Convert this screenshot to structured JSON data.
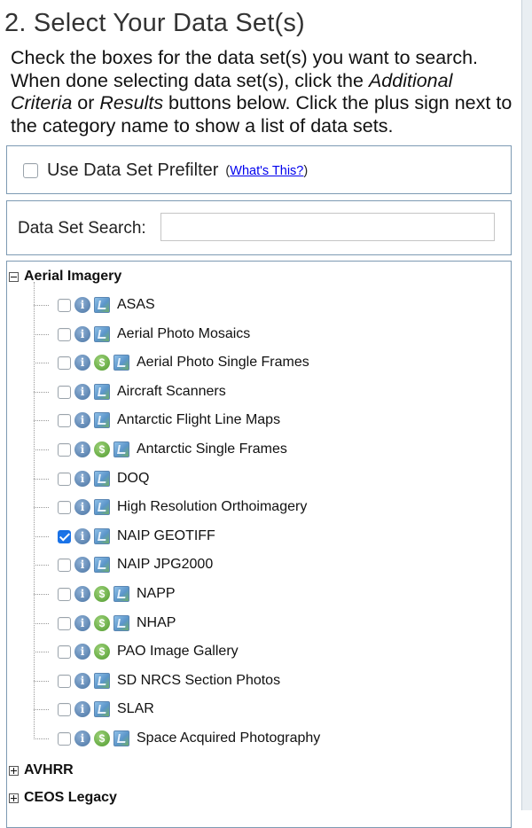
{
  "step": {
    "title": "2. Select Your Data Set(s)"
  },
  "instructions": {
    "part1": "Check the boxes for the data set(s) you want to search. When done selecting data set(s), click the ",
    "em1": "Additional Criteria",
    "part2": " or ",
    "em2": "Results",
    "part3": " buttons below. Click the plus sign next to the category name to show a list of data sets."
  },
  "prefilter": {
    "label": "Use Data Set Prefilter",
    "paren_open": "(",
    "link": "What's This?",
    "paren_close": ")",
    "checked": false
  },
  "search": {
    "label": "Data Set Search:",
    "value": "",
    "placeholder": ""
  },
  "tree": {
    "aerial": {
      "label": "Aerial Imagery",
      "expanded": true,
      "items": [
        {
          "label": "ASAS",
          "checked": false,
          "icons": [
            "info-icon",
            "map-icon"
          ]
        },
        {
          "label": "Aerial Photo Mosaics",
          "checked": false,
          "icons": [
            "info-icon",
            "map-icon"
          ]
        },
        {
          "label": "Aerial Photo Single Frames",
          "checked": false,
          "icons": [
            "info-icon",
            "dollar-icon",
            "map-icon"
          ]
        },
        {
          "label": "Aircraft Scanners",
          "checked": false,
          "icons": [
            "info-icon",
            "map-icon"
          ]
        },
        {
          "label": "Antarctic Flight Line Maps",
          "checked": false,
          "icons": [
            "info-icon",
            "map-icon"
          ]
        },
        {
          "label": "Antarctic Single Frames",
          "checked": false,
          "icons": [
            "info-icon",
            "dollar-icon",
            "map-icon"
          ]
        },
        {
          "label": "DOQ",
          "checked": false,
          "icons": [
            "info-icon",
            "map-icon"
          ]
        },
        {
          "label": "High Resolution Orthoimagery",
          "checked": false,
          "icons": [
            "info-icon",
            "map-icon"
          ]
        },
        {
          "label": "NAIP GEOTIFF",
          "checked": true,
          "icons": [
            "info-icon",
            "map-icon"
          ]
        },
        {
          "label": "NAIP JPG2000",
          "checked": false,
          "icons": [
            "info-icon",
            "map-icon"
          ]
        },
        {
          "label": "NAPP",
          "checked": false,
          "icons": [
            "info-icon",
            "dollar-icon",
            "map-icon"
          ]
        },
        {
          "label": "NHAP",
          "checked": false,
          "icons": [
            "info-icon",
            "dollar-icon",
            "map-icon"
          ]
        },
        {
          "label": "PAO Image Gallery",
          "checked": false,
          "icons": [
            "info-icon",
            "dollar-icon"
          ]
        },
        {
          "label": "SD NRCS Section Photos",
          "checked": false,
          "icons": [
            "info-icon",
            "map-icon"
          ]
        },
        {
          "label": "SLAR",
          "checked": false,
          "icons": [
            "info-icon",
            "map-icon"
          ]
        },
        {
          "label": "Space Acquired Photography",
          "checked": false,
          "icons": [
            "info-icon",
            "dollar-icon",
            "map-icon"
          ]
        }
      ]
    },
    "avhrr": {
      "label": "AVHRR",
      "expanded": false
    },
    "ceos": {
      "label": "CEOS Legacy",
      "expanded": false
    }
  },
  "colors": {
    "panel_border": "#7d9ab3",
    "link": "#0000ee",
    "checkbox_checked": "#1a73e8"
  }
}
